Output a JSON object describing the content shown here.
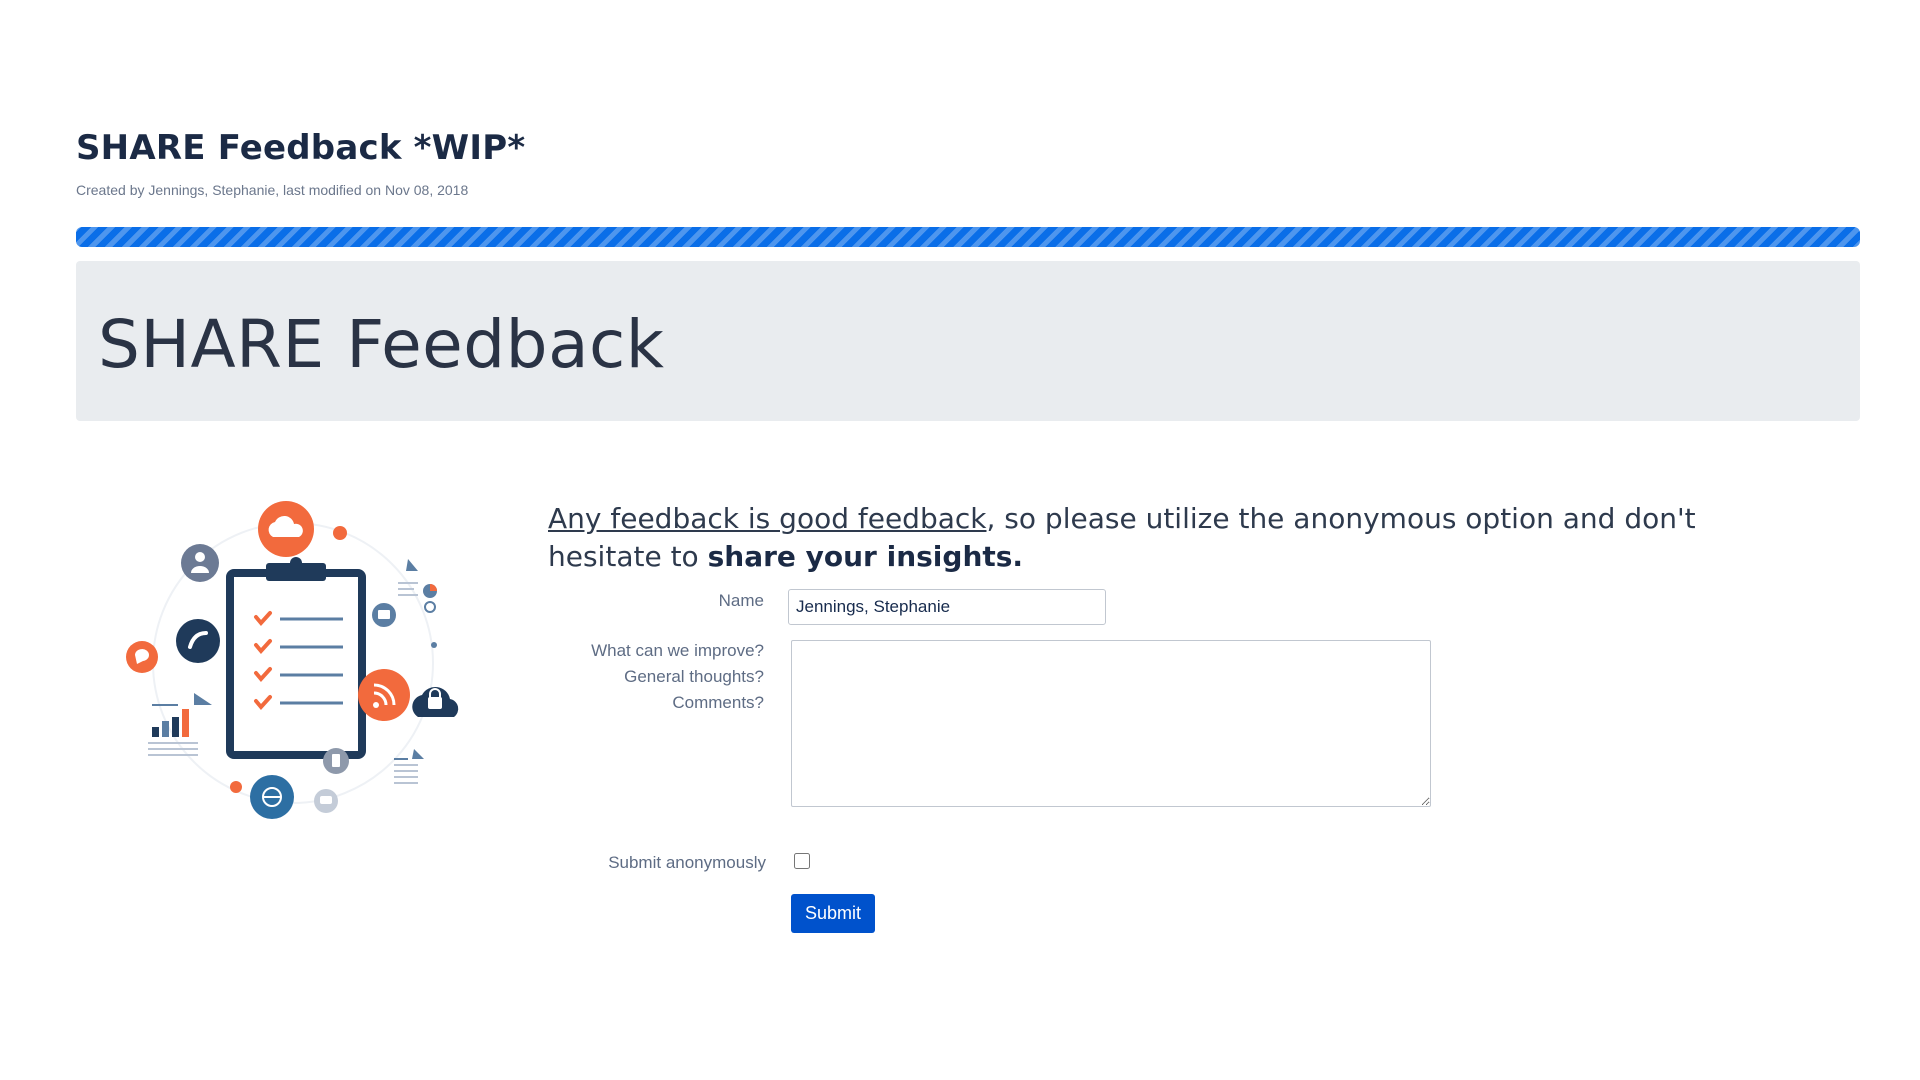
{
  "header": {
    "title": "SHARE Feedback *WIP*",
    "byline": "Created by Jennings, Stephanie, last modified on Nov 08, 2018"
  },
  "progress": {
    "percent": 100,
    "color": "#0a6ee8"
  },
  "jumbotron": {
    "title": "SHARE Feedback"
  },
  "illustration": {
    "icon_names": [
      "clipboard-checklist-icon",
      "cloud-icon",
      "user-icon",
      "phone-icon",
      "rss-icon",
      "cloud-lock-icon",
      "globe-icon",
      "chat-icon",
      "bar-chart-icon",
      "document-icon"
    ],
    "colors": {
      "orange": "#f26a3d",
      "navy": "#1f3a5a",
      "steel": "#5b7ea3"
    }
  },
  "intro": {
    "link_text": "Any feedback is good feedback",
    "middle_text": ", so please utilize the anonymous option and don't hesitate to ",
    "bold_text": "share your insights."
  },
  "form": {
    "name_label": "Name",
    "name_value": "Jennings, Stephanie",
    "improve_label_lines": [
      "What can we improve?",
      "General thoughts?",
      "Comments?"
    ],
    "feedback_value": "",
    "anonymous_label": "Submit anonymously",
    "anonymous_checked": false,
    "submit_label": "Submit"
  },
  "colors": {
    "primary_button": "#0052cc",
    "jumbotron_bg": "#e9ecef"
  }
}
